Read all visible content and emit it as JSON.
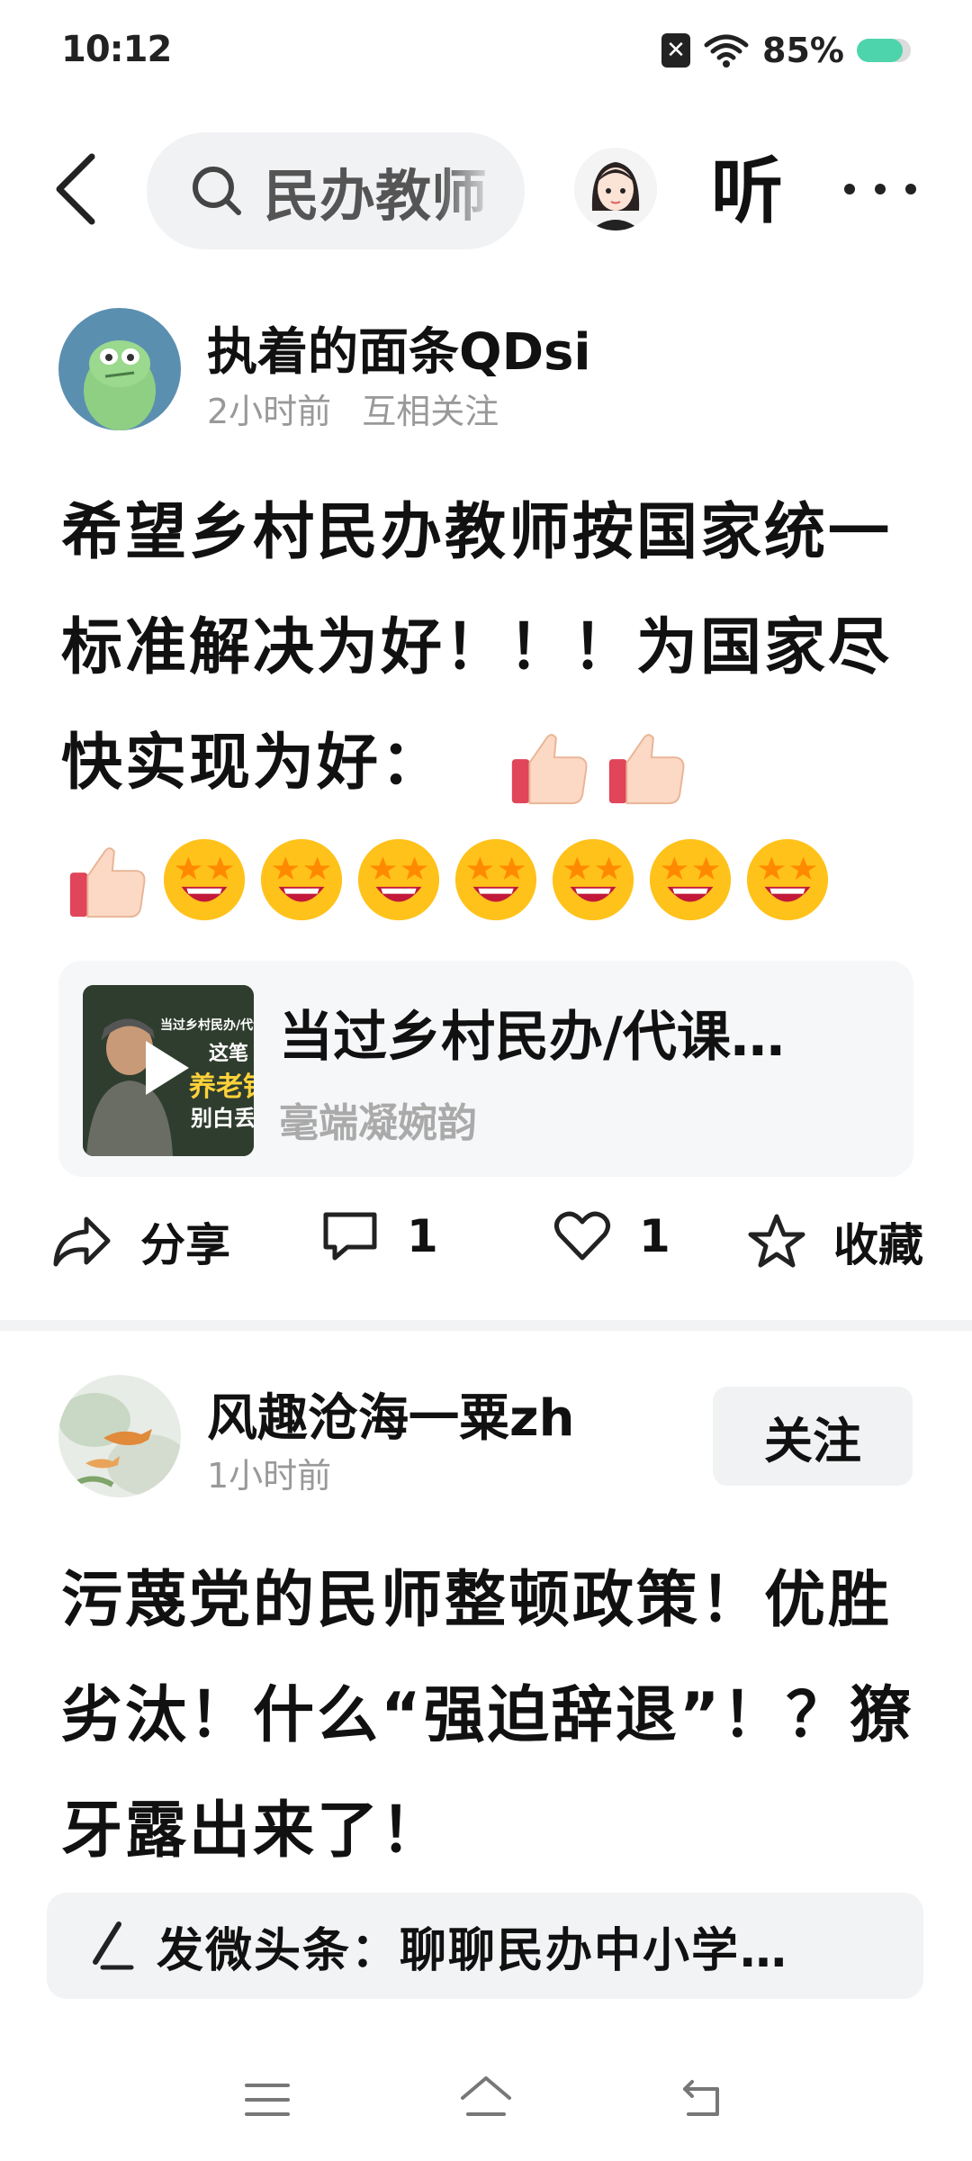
{
  "status_bar": {
    "time": "10:12",
    "battery": "85%",
    "battery_level": 0.85
  },
  "top_nav": {
    "search_text": "民办教师",
    "listen_label": "听"
  },
  "posts": [
    {
      "author": "执着的面条QDsi",
      "time": "2小时前",
      "relation": "互相关注",
      "body": "希望乡村民办教师按国家统一标准解决为好！！！为国家尽快实现为好：",
      "link_card": {
        "title": "当过乡村民办/代课…",
        "subtitle": "毫端凝婉韵",
        "thumb_lines": [
          "当过乡村民办/代课",
          "这笔",
          "养老钱",
          "别白丢"
        ]
      },
      "actions": {
        "share": "分享",
        "comments": "1",
        "likes": "1",
        "favorite": "收藏"
      }
    },
    {
      "author": "风趣沧海一粟zh",
      "time": "1小时前",
      "follow_label": "关注",
      "body": "污蔑党的民师整顿政策！优胜劣汰！什么“强迫辞退”！？獠牙露出来了！"
    }
  ],
  "publish_bar": {
    "text": "发微头条：聊聊民办中小学…"
  },
  "colors": {
    "battery": "#4dd4ac",
    "background": "#ffffff",
    "muted": "#999999"
  }
}
